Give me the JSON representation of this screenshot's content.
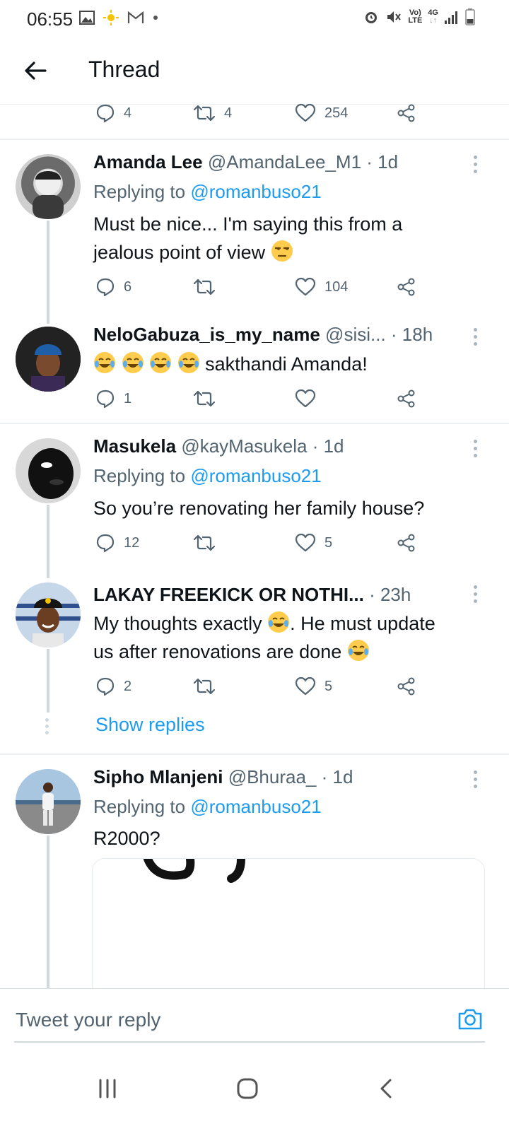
{
  "status_bar": {
    "time": "06:55",
    "left_icons": [
      "image-icon",
      "sun-icon",
      "gmail-icon",
      "dot-icon"
    ],
    "network_top": "Vo)",
    "network_bottom": "LTE",
    "signal_type": "4G"
  },
  "header": {
    "title": "Thread"
  },
  "top_actions": {
    "replies": "4",
    "retweets": "4",
    "likes": "254"
  },
  "tweets": [
    {
      "name": "Amanda Lee",
      "handle": "@AmandaLee_M1",
      "time": "· 1d",
      "replying_prefix": "Replying to",
      "replying_to": "@romanbuso21",
      "text_line1": "Must be nice... I'm saying this from a",
      "text_line2": "jealous point of view",
      "replies": "6",
      "retweets": "",
      "likes": "104"
    },
    {
      "name": "NeloGabuza_is_my_name",
      "handle": "@sisi...",
      "time": "· 18h",
      "text": "sakthandi Amanda!",
      "replies": "1",
      "retweets": "",
      "likes": ""
    },
    {
      "name": "Masukela",
      "handle": "@kayMasukela",
      "time": "· 1d",
      "replying_prefix": "Replying to",
      "replying_to": "@romanbuso21",
      "text": "So you’re renovating her family house?",
      "replies": "12",
      "retweets": "",
      "likes": "5"
    },
    {
      "name": "LAKAY FREEKICK OR NOTHI...",
      "handle": "",
      "time": "· 23h",
      "text_line1a": "My thoughts exactly",
      "text_line1b": ". He must update",
      "text_line2": "us after renovations are done",
      "replies": "2",
      "retweets": "",
      "likes": "5"
    },
    {
      "name": "Sipho Mlanjeni",
      "handle": "@Bhuraa_",
      "time": "· 1d",
      "replying_prefix": "Replying to",
      "replying_to": "@romanbuso21",
      "text": "R2000?"
    }
  ],
  "show_replies_label": "Show replies",
  "compose": {
    "placeholder": "Tweet your reply"
  },
  "colors": {
    "accent": "#1d9bf0",
    "muted": "#536471",
    "divider": "#eceff1"
  }
}
